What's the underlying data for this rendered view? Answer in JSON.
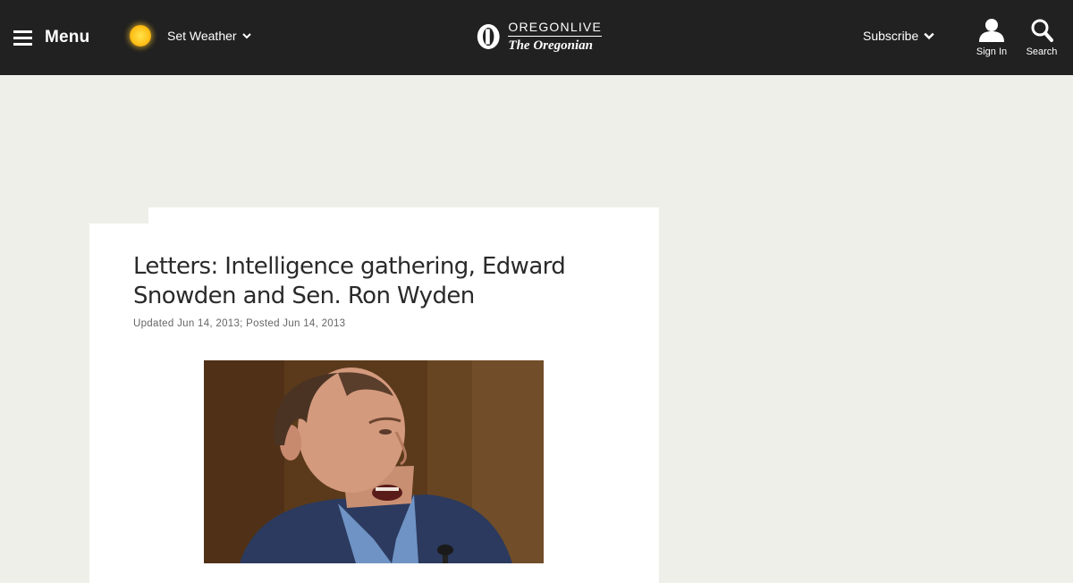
{
  "header": {
    "menu_label": "Menu",
    "weather_label": "Set Weather",
    "logo_top": "OREGONLIVE",
    "logo_bottom": "The Oregonian",
    "subscribe_label": "Subscribe",
    "signin_label": "Sign In",
    "search_label": "Search"
  },
  "article": {
    "headline": "Letters: Intelligence gathering, Edward Snowden and Sen. Ron Wyden",
    "meta": "Updated Jun 14, 2013; Posted Jun 14, 2013"
  },
  "colors": {
    "topbar": "#212121",
    "page_bg": "#efefea",
    "card_bg": "#ffffff",
    "headline": "#2a2a2a"
  },
  "icons": [
    "hamburger-icon",
    "sun-icon",
    "chevron-down-icon",
    "oregonian-o-logo",
    "user-icon",
    "search-icon"
  ]
}
